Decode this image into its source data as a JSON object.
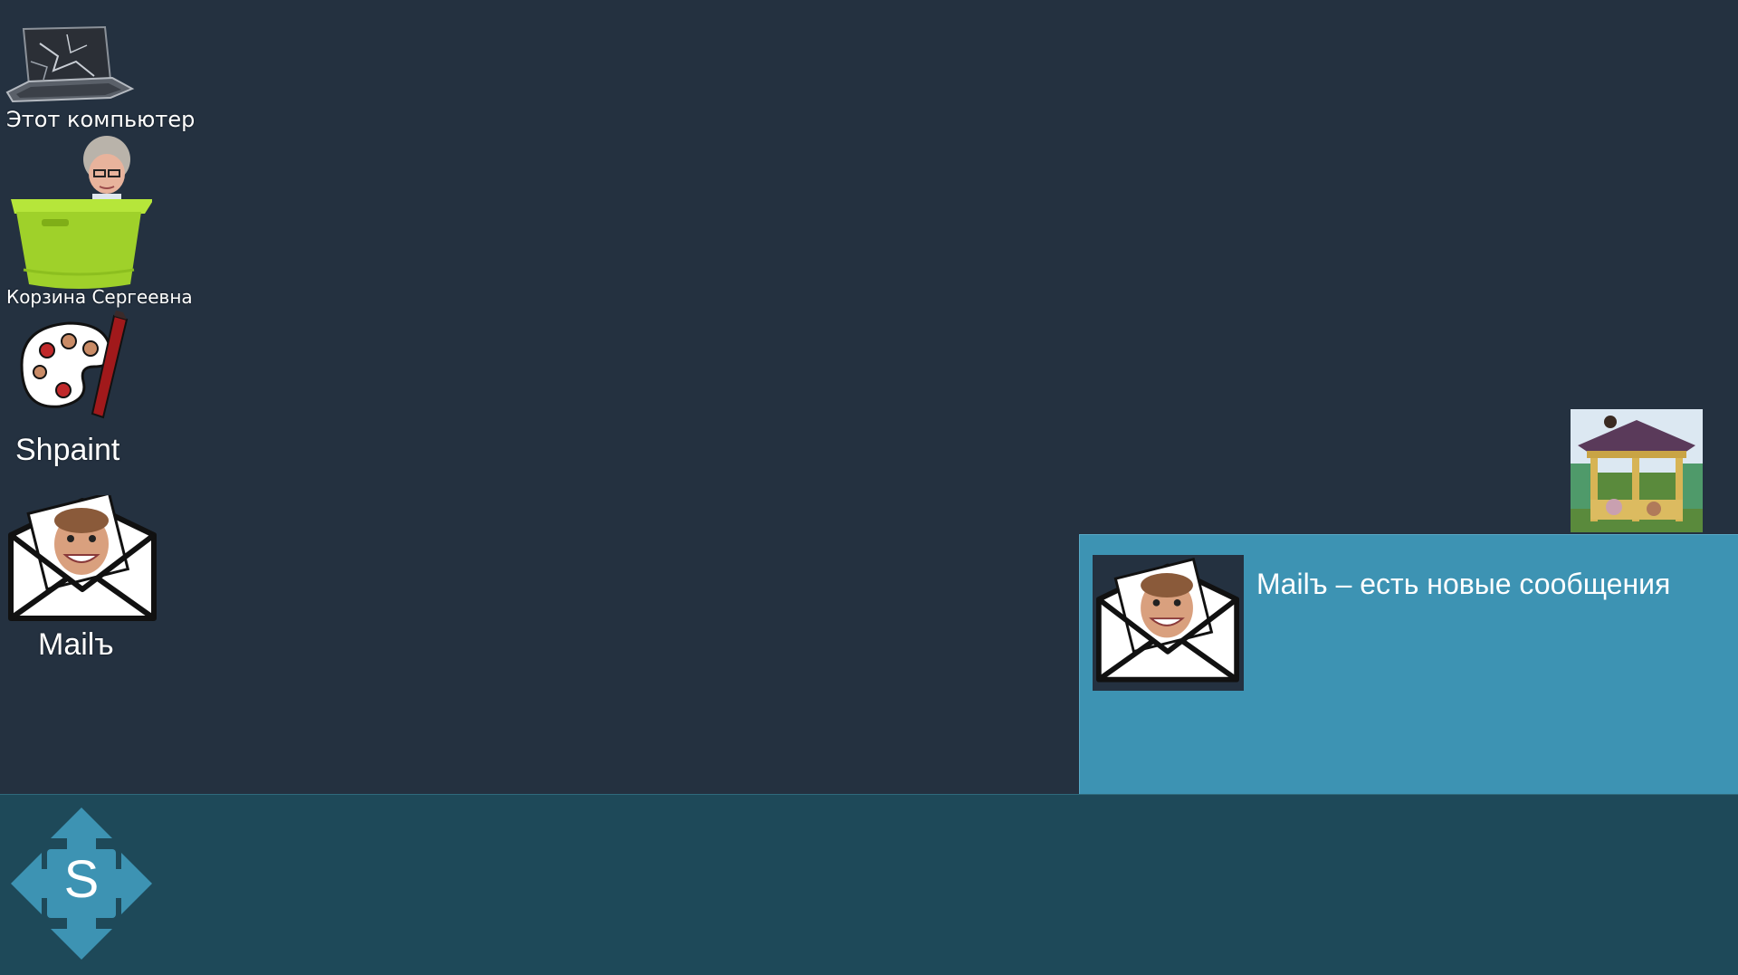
{
  "desktop": {
    "icons": [
      {
        "id": "computer",
        "label": "Этот компьютер",
        "icon": "broken-laptop-icon"
      },
      {
        "id": "recycle",
        "label": "Корзина Сергеевна",
        "icon": "green-basket-icon"
      },
      {
        "id": "shpaint",
        "label": "Shpaint",
        "icon": "paint-palette-icon"
      },
      {
        "id": "mail",
        "label": "Mailъ",
        "icon": "mail-envelope-icon"
      }
    ],
    "widget": {
      "icon": "gazebo-photo-icon"
    }
  },
  "notification": {
    "text": "Mailъ – есть новые сообщения",
    "icon": "mail-envelope-icon"
  },
  "taskbar": {
    "start_label": "S",
    "start_icon": "move-arrows-icon"
  },
  "colors": {
    "desktop_bg": "#243140",
    "notification_bg": "#3d93b3",
    "taskbar_bg": "#1e4959",
    "start_arrows": "#3d93b3",
    "label_text": "#ffffff"
  }
}
